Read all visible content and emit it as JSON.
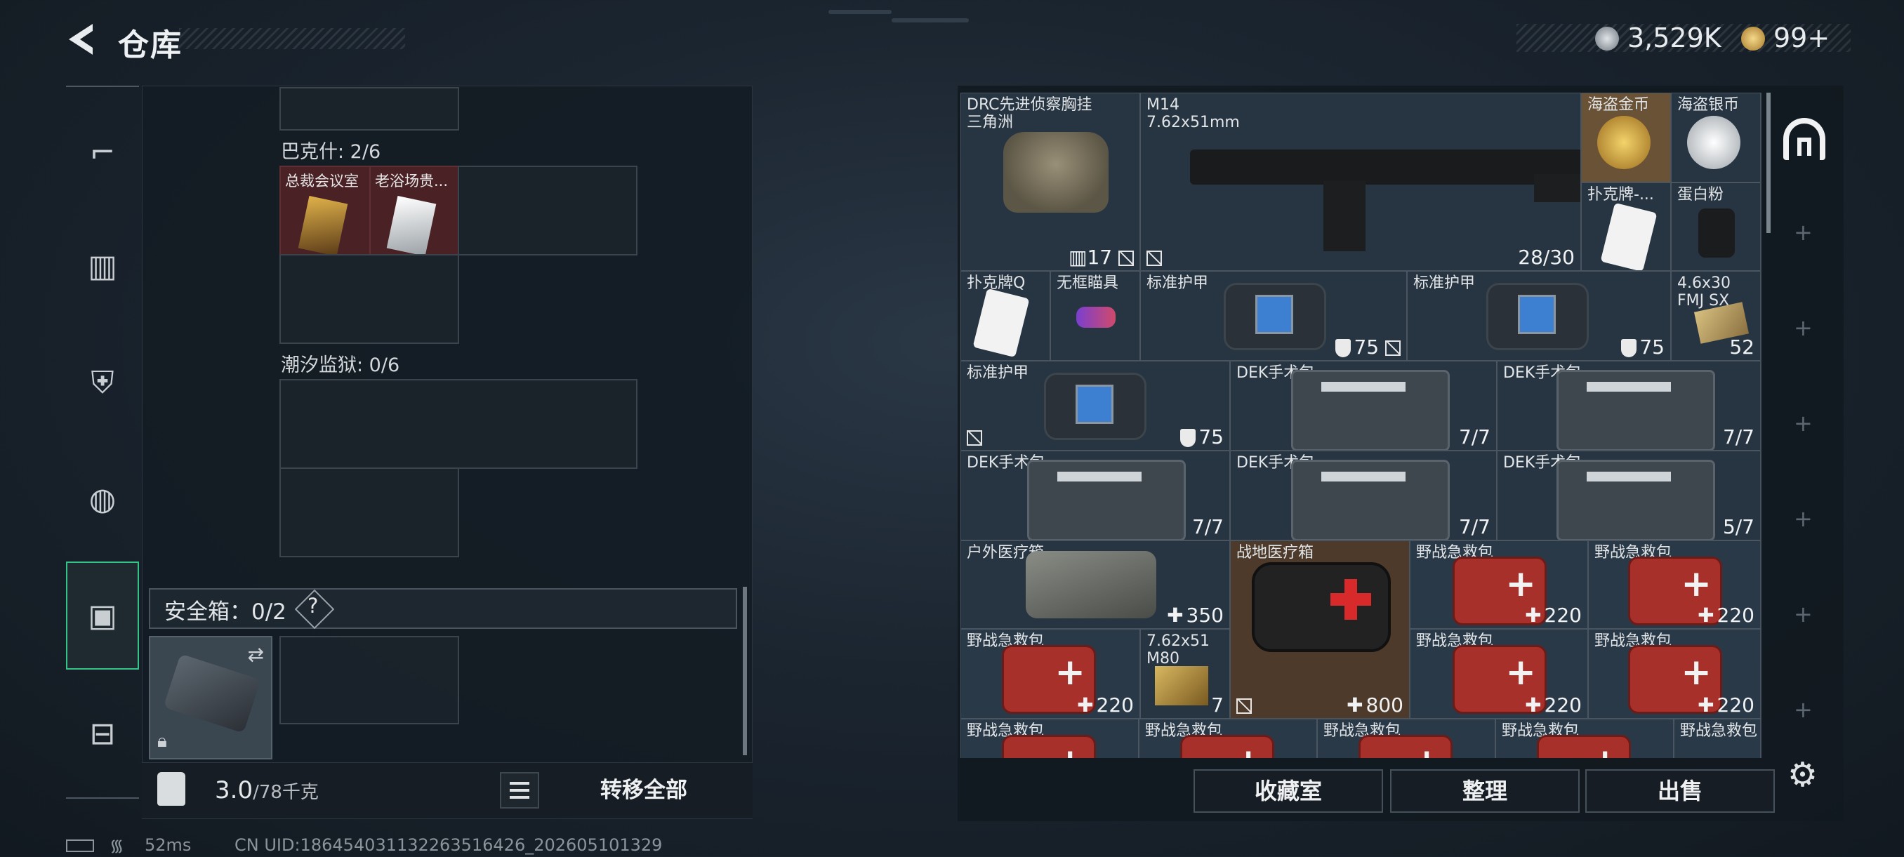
{
  "header": {
    "title": "仓库"
  },
  "currency": {
    "silver": "3,529K",
    "gold": "99+"
  },
  "nav": {
    "items": [
      "weapon-icon",
      "vest-icon",
      "armor-icon",
      "backpack-icon",
      "container-icon",
      "case-icon"
    ],
    "active": "container-icon"
  },
  "left": {
    "bakshi_label": "巴克什: 2/6",
    "bakshi_keys": [
      "总裁会议室",
      "老浴场贵..."
    ],
    "tide_label": "潮汐监狱: 0/6",
    "safe_label": "安全箱：0/2",
    "safe_help": "?",
    "weight_value": "3.0",
    "weight_max": "/78千克",
    "transfer_all": "转移全部"
  },
  "inventory": {
    "items": [
      {
        "name": "DRC先进侦察胸挂\n三角洲",
        "qty": "17"
      },
      {
        "name": "M14\n7.62x51mm",
        "qty": "28/30"
      },
      {
        "name": "海盗金币",
        "qty": ""
      },
      {
        "name": "海盗银币",
        "qty": ""
      },
      {
        "name": "扑克牌-...",
        "qty": ""
      },
      {
        "name": "蛋白粉",
        "qty": ""
      },
      {
        "name": "扑克牌Q",
        "qty": ""
      },
      {
        "name": "无框瞄具",
        "qty": ""
      },
      {
        "name": "标准护甲",
        "qty": "75"
      },
      {
        "name": "标准护甲",
        "qty": "75"
      },
      {
        "name": "4.6x30\nFMJ SX",
        "qty": "52"
      },
      {
        "name": "标准护甲",
        "qty": "75"
      },
      {
        "name": "DEK手术包",
        "qty": "7/7"
      },
      {
        "name": "DEK手术包",
        "qty": "7/7"
      },
      {
        "name": "DEK手术包",
        "qty": "7/7"
      },
      {
        "name": "DEK手术包",
        "qty": "7/7"
      },
      {
        "name": "DEK手术包",
        "qty": "5/7"
      },
      {
        "name": "户外医疗箱",
        "qty": "350"
      },
      {
        "name": "战地医疗箱",
        "qty": "800"
      },
      {
        "name": "野战急救包",
        "qty": "220"
      },
      {
        "name": "野战急救包",
        "qty": "220"
      },
      {
        "name": "野战急救包",
        "qty": "220"
      },
      {
        "name": "7.62x51\nM80",
        "qty": "7"
      },
      {
        "name": "野战急救包",
        "qty": "220"
      },
      {
        "name": "野战急救包",
        "qty": "220"
      },
      {
        "name": "野战急救包",
        "qty": ""
      },
      {
        "name": "野战急救包",
        "qty": ""
      },
      {
        "name": "野战急救包",
        "qty": ""
      },
      {
        "name": "野战急救包",
        "qty": ""
      },
      {
        "name": "野战急救包",
        "qty": ""
      }
    ]
  },
  "footer": {
    "collection": "收藏室",
    "sort": "整理",
    "sell": "出售"
  },
  "status": {
    "ping": "52ms",
    "uid": "CN UID:1864540311322635164​26_202605101329"
  }
}
